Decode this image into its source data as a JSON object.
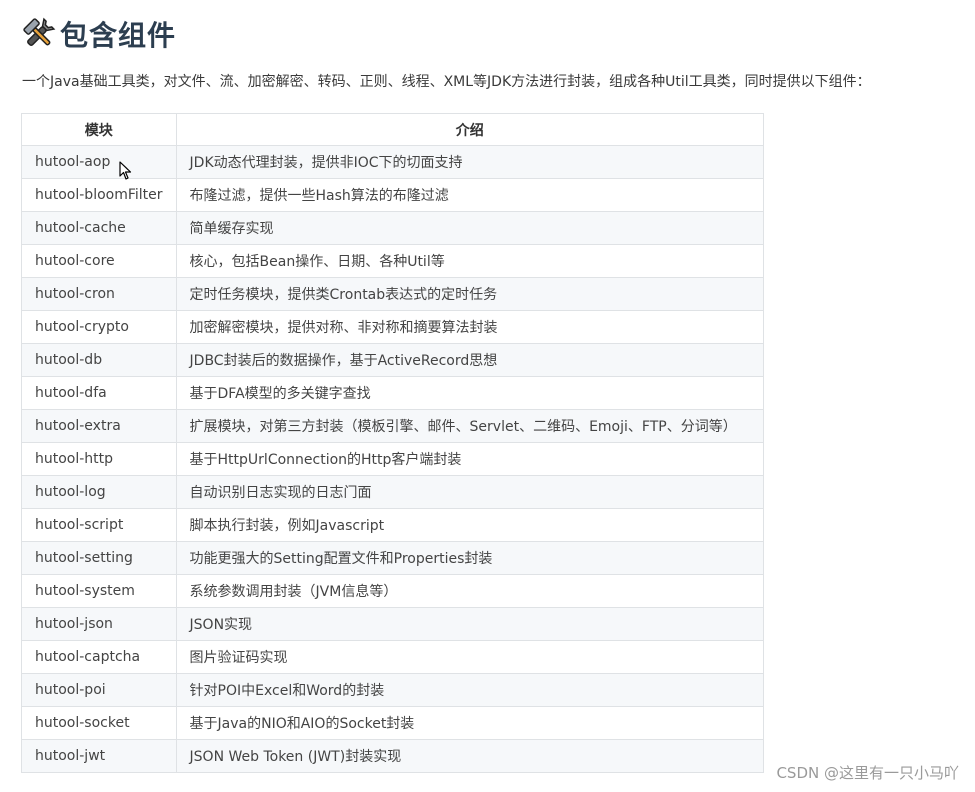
{
  "heading": {
    "icon": "tools-icon",
    "title": "包含组件"
  },
  "intro": "一个Java基础工具类，对文件、流、加密解密、转码、正则、线程、XML等JDK方法进行封装，组成各种Util工具类，同时提供以下组件：",
  "table": {
    "headers": [
      "模块",
      "介绍"
    ],
    "rows": [
      {
        "module": "hutool-aop",
        "desc": "JDK动态代理封装，提供非IOC下的切面支持"
      },
      {
        "module": "hutool-bloomFilter",
        "desc": "布隆过滤，提供一些Hash算法的布隆过滤"
      },
      {
        "module": "hutool-cache",
        "desc": "简单缓存实现"
      },
      {
        "module": "hutool-core",
        "desc": "核心，包括Bean操作、日期、各种Util等"
      },
      {
        "module": "hutool-cron",
        "desc": "定时任务模块，提供类Crontab表达式的定时任务"
      },
      {
        "module": "hutool-crypto",
        "desc": "加密解密模块，提供对称、非对称和摘要算法封装"
      },
      {
        "module": "hutool-db",
        "desc": "JDBC封装后的数据操作，基于ActiveRecord思想"
      },
      {
        "module": "hutool-dfa",
        "desc": "基于DFA模型的多关键字查找"
      },
      {
        "module": "hutool-extra",
        "desc": "扩展模块，对第三方封装（模板引擎、邮件、Servlet、二维码、Emoji、FTP、分词等）"
      },
      {
        "module": "hutool-http",
        "desc": "基于HttpUrlConnection的Http客户端封装"
      },
      {
        "module": "hutool-log",
        "desc": "自动识别日志实现的日志门面"
      },
      {
        "module": "hutool-script",
        "desc": "脚本执行封装，例如Javascript"
      },
      {
        "module": "hutool-setting",
        "desc": "功能更强大的Setting配置文件和Properties封装"
      },
      {
        "module": "hutool-system",
        "desc": "系统参数调用封装（JVM信息等）"
      },
      {
        "module": "hutool-json",
        "desc": "JSON实现"
      },
      {
        "module": "hutool-captcha",
        "desc": "图片验证码实现"
      },
      {
        "module": "hutool-poi",
        "desc": "针对POI中Excel和Word的封装"
      },
      {
        "module": "hutool-socket",
        "desc": "基于Java的NIO和AIO的Socket封装"
      },
      {
        "module": "hutool-jwt",
        "desc": "JSON Web Token (JWT)封装实现"
      }
    ]
  },
  "watermark": "CSDN @这里有一只小马吖",
  "colors": {
    "heading": "#2c3e50",
    "border": "#dfe2e5",
    "stripe": "#f6f8fa"
  }
}
